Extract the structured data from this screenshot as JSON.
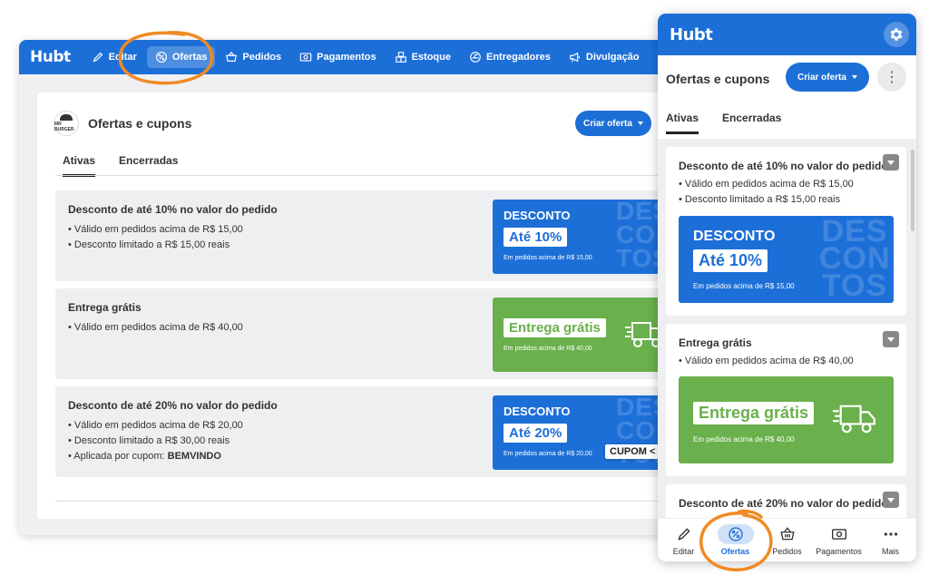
{
  "colors": {
    "primary": "#1d6fd8",
    "green": "#6ab04c",
    "annotation": "#f08a24"
  },
  "desktop": {
    "logo": "Hubt",
    "nav": [
      {
        "label": "Editar",
        "icon": "pencil-icon"
      },
      {
        "label": "Ofertas",
        "icon": "percent-badge-icon",
        "active": true
      },
      {
        "label": "Pedidos",
        "icon": "basket-icon"
      },
      {
        "label": "Pagamentos",
        "icon": "money-icon"
      },
      {
        "label": "Estoque",
        "icon": "boxes-icon"
      },
      {
        "label": "Entregadores",
        "icon": "motorcycle-icon"
      },
      {
        "label": "Divulgação",
        "icon": "megaphone-icon"
      }
    ],
    "brand_avatar": "MR BURGER",
    "page_title": "Ofertas e cupons",
    "criar_oferta": "Criar oferta",
    "tabs": [
      "Ativas",
      "Encerradas"
    ],
    "offers": [
      {
        "title": "Desconto de até 10% no valor do pedido",
        "lines": [
          "• Válido em pedidos acima de R$ 15,00",
          "• Desconto limitado a R$ 15,00 reais"
        ],
        "banner": {
          "type": "discount",
          "title": "DESCONTO",
          "pill": "Até 10%",
          "sub": "Em pedidos acima de R$ 15,00",
          "bg": "DES CON TOS"
        }
      },
      {
        "title": "Entrega grátis",
        "lines": [
          "• Válido em pedidos acima de R$ 40,00"
        ],
        "banner": {
          "type": "delivery",
          "pill": "Entrega grátis",
          "sub": "Em pedidos acima de R$ 40,00"
        }
      },
      {
        "title": "Desconto de até 20% no valor do pedido",
        "lines": [
          "• Válido em pedidos acima de R$ 20,00",
          "• Desconto limitado a R$ 30,00 reais"
        ],
        "coupon_line_prefix": "• Aplicada por cupom: ",
        "coupon_code": "BEMVINDO",
        "banner": {
          "type": "discount",
          "title": "DESCONTO",
          "pill": "Até 20%",
          "sub": "Em pedidos acima de R$ 20,00",
          "bg": "DES CON TOS",
          "cupom_tag": "CUPOM <"
        }
      }
    ]
  },
  "mobile": {
    "logo": "Hubt",
    "page_title": "Ofertas e cupons",
    "criar_oferta": "Criar oferta",
    "more": "⋮",
    "tabs": [
      "Ativas",
      "Encerradas"
    ],
    "cards": [
      {
        "title": "Desconto de até 10% no valor do pedido",
        "lines": [
          "• Válido em pedidos acima de R$ 15,00",
          "• Desconto limitado a R$ 15,00 reais"
        ],
        "banner": {
          "title": "DESCONTO",
          "pill": "Até 10%",
          "sub": "Em pedidos acima de R$ 15,00",
          "bg": "DES CON TOS"
        }
      },
      {
        "title": "Entrega grátis",
        "lines": [
          "• Válido em pedidos acima de R$ 40,00"
        ],
        "banner": {
          "pill": "Entrega grátis",
          "sub": "Em pedidos acima de R$ 40,00"
        }
      },
      {
        "title": "Desconto de até 20% no valor do pedido"
      }
    ],
    "bottom_nav": [
      {
        "label": "Editar",
        "icon": "pencil-icon"
      },
      {
        "label": "Ofertas",
        "icon": "percent-badge-icon",
        "active": true
      },
      {
        "label": "Pedidos",
        "icon": "basket-icon"
      },
      {
        "label": "Pagamentos",
        "icon": "money-icon"
      },
      {
        "label": "Mais",
        "icon": "more-dots-icon"
      }
    ]
  }
}
